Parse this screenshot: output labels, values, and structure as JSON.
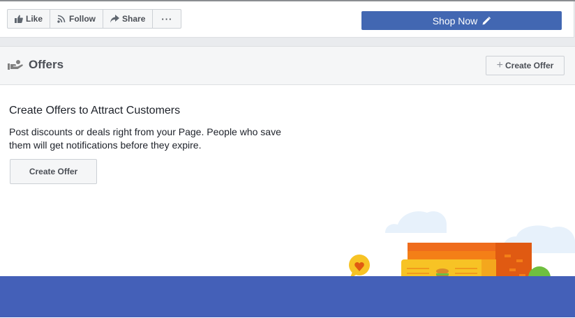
{
  "actionbar": {
    "like_label": "Like",
    "follow_label": "Follow",
    "share_label": "Share",
    "more_label": "···",
    "shop_label": "Shop Now"
  },
  "offers": {
    "title": "Offers",
    "create_top_label": "Create Offer",
    "heading": "Create Offers to Attract Customers",
    "description": "Post discounts or deals right from your Page. People who save them will get notifications before they expire.",
    "create_main_label": "Create Offer"
  },
  "colors": {
    "brand_blue": "#4267b2",
    "band_blue": "#4460b8",
    "text_dark": "#1d2129"
  }
}
